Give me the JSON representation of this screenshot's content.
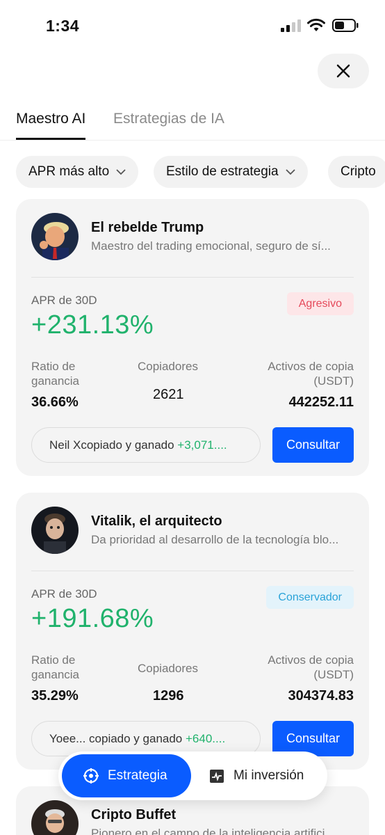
{
  "status_bar": {
    "time": "1:34"
  },
  "tabs": [
    {
      "label": "Maestro AI",
      "active": true
    },
    {
      "label": "Estrategias de IA",
      "active": false
    }
  ],
  "filters": [
    {
      "label": "APR más alto"
    },
    {
      "label": "Estilo de estrategia"
    },
    {
      "label": "Cripto"
    }
  ],
  "cards": [
    {
      "name": "El rebelde Trump",
      "description": "Maestro del trading emocional, seguro de sí...",
      "apr_label": "APR de 30D",
      "apr_value": "+231.13%",
      "badge": "Agresivo",
      "stats": {
        "win_rate_label": "Ratio de ganancia",
        "win_rate": "36.66%",
        "copiers_label": "Copiadores",
        "copiers": "2621",
        "assets_label": "Activos de copia (USDT)",
        "assets": "442252.11"
      },
      "copy_text": "Neil Xcopiado y ganado ",
      "copy_gain": "+3,071....",
      "button": "Consultar"
    },
    {
      "name": "Vitalik, el arquitecto",
      "description": "Da prioridad al desarrollo de la tecnología blo...",
      "apr_label": "APR de 30D",
      "apr_value": "+191.68%",
      "badge": "Conservador",
      "stats": {
        "win_rate_label": "Ratio de ganancia",
        "win_rate": "35.29%",
        "copiers_label": "Copiadores",
        "copiers": "1296",
        "assets_label": "Activos de copia (USDT)",
        "assets": "304374.83"
      },
      "copy_text": "Yoee... copiado y ganado ",
      "copy_gain": "+640....",
      "button": "Consultar"
    },
    {
      "name": "Cripto Buffet",
      "description": "Pionero en el campo de la inteligencia artifici..."
    }
  ],
  "bottom_nav": {
    "active_label": "Estrategia",
    "inactive_label": "Mi inversión"
  },
  "colors": {
    "accent": "#0a5cff",
    "positive": "#20b26c",
    "aggressive": "#e5495a",
    "conservative": "#2aa3d8"
  }
}
